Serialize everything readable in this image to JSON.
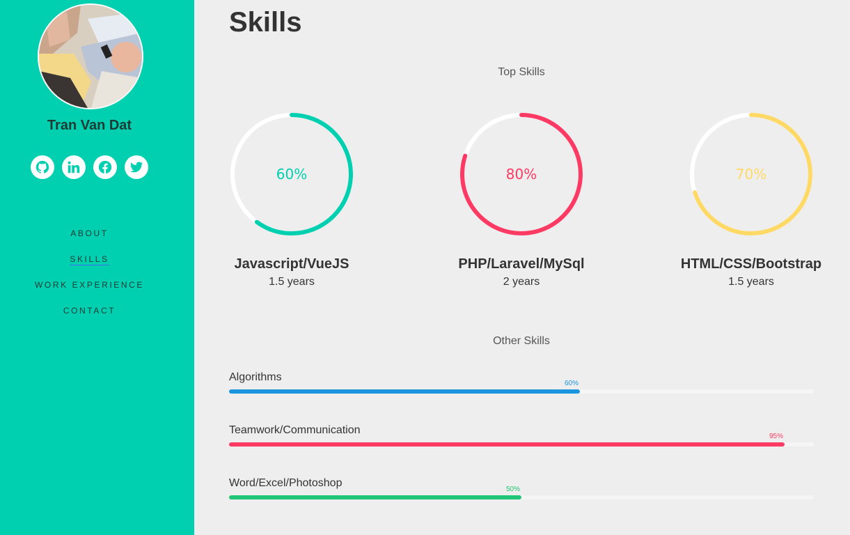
{
  "sidebar": {
    "profile_name": "Tran Van Dat",
    "social_links": [
      {
        "icon": "github-icon"
      },
      {
        "icon": "linkedin-icon"
      },
      {
        "icon": "facebook-icon"
      },
      {
        "icon": "twitter-icon"
      }
    ],
    "nav": [
      {
        "label": "ABOUT",
        "active": false
      },
      {
        "label": "SKILLS",
        "active": true
      },
      {
        "label": "WORK EXPERIENCE",
        "active": false
      },
      {
        "label": "CONTACT",
        "active": false
      }
    ],
    "background_color": "#00cfb0",
    "icon_color": "#00cfb0"
  },
  "main": {
    "title": "Skills",
    "top_skills": {
      "heading": "Top Skills",
      "items": [
        {
          "name": "Javascript/VueJS",
          "years": "1.5 years",
          "percent": 60,
          "percent_label": "60%",
          "color": "#00cfb0"
        },
        {
          "name": "PHP/Laravel/MySql",
          "years": "2 years",
          "percent": 80,
          "percent_label": "80%",
          "color": "#fd3a64"
        },
        {
          "name": "HTML/CSS/Bootstrap",
          "years": "1.5 years",
          "percent": 70,
          "percent_label": "70%",
          "color": "#ffd966"
        }
      ]
    },
    "other_skills": {
      "heading": "Other Skills",
      "items": [
        {
          "name": "Algorithms",
          "percent": 60,
          "percent_label": "60%",
          "color": "#1b95e0"
        },
        {
          "name": "Teamwork/Communication",
          "percent": 95,
          "percent_label": "95%",
          "color": "#fd3a64"
        },
        {
          "name": "Word/Excel/Photoshop",
          "percent": 50,
          "percent_label": "50%",
          "color": "#1fc677"
        }
      ]
    }
  }
}
